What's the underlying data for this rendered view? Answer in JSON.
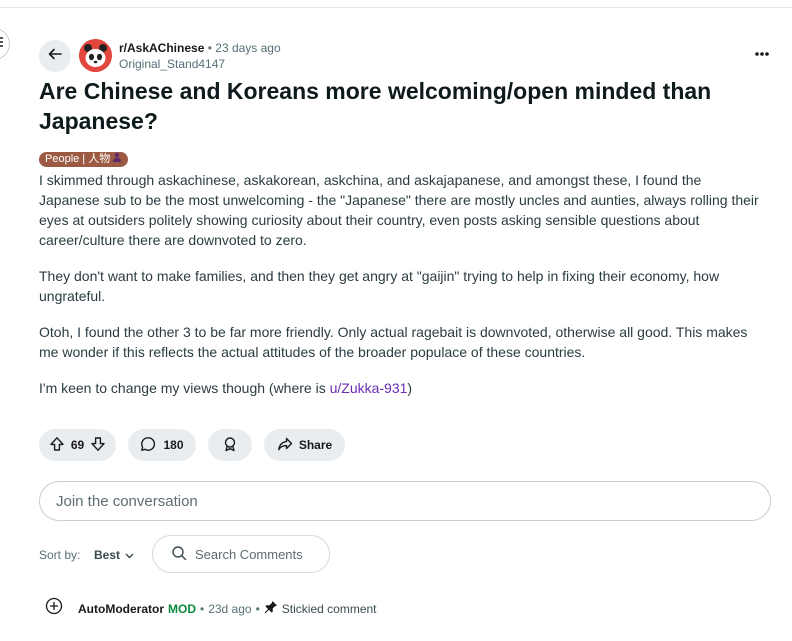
{
  "post": {
    "subreddit": "r/AskAChinese",
    "age": "23 days ago",
    "author": "Original_Stand4147",
    "title": "Are Chinese and Koreans more welcoming/open minded than Japanese?",
    "flair": "People | 人物",
    "paragraphs": [
      "I skimmed through askachinese, askakorean, askchina, and askajapanese, and amongst these, I found the Japanese sub to be the most unwelcoming - the \"Japanese\" there are mostly uncles and aunties, always rolling their eyes at outsiders politely showing curiosity about their country, even posts asking sensible questions about career/culture there are downvoted to zero.",
      "They don't want to make families, and then they get angry at \"gaijin\" trying to help in fixing their economy, how ungrateful.",
      "Otoh, I found the other 3 to be far more friendly. Only actual ragebait is downvoted, otherwise all good. This makes me wonder if this reflects the actual attitudes of the broader populace of these countries."
    ],
    "last_paragraph_prefix": "I'm keen to change my views though (where is ",
    "user_link": "u/Zukka-931",
    "last_paragraph_suffix": ")"
  },
  "actions": {
    "votes": "69",
    "comments": "180",
    "share": "Share"
  },
  "comment_box": {
    "placeholder": "Join the conversation"
  },
  "sort": {
    "label": "Sort by:",
    "value": "Best",
    "search_placeholder": "Search Comments"
  },
  "first_comment": {
    "author": "AutoModerator",
    "badge": "MOD",
    "age": "23d ago",
    "status": "Stickied comment"
  },
  "colors": {
    "flair_bg": "#9c5a43",
    "mod_green": "#0b8a3e",
    "user_link": "#6a2db3"
  }
}
